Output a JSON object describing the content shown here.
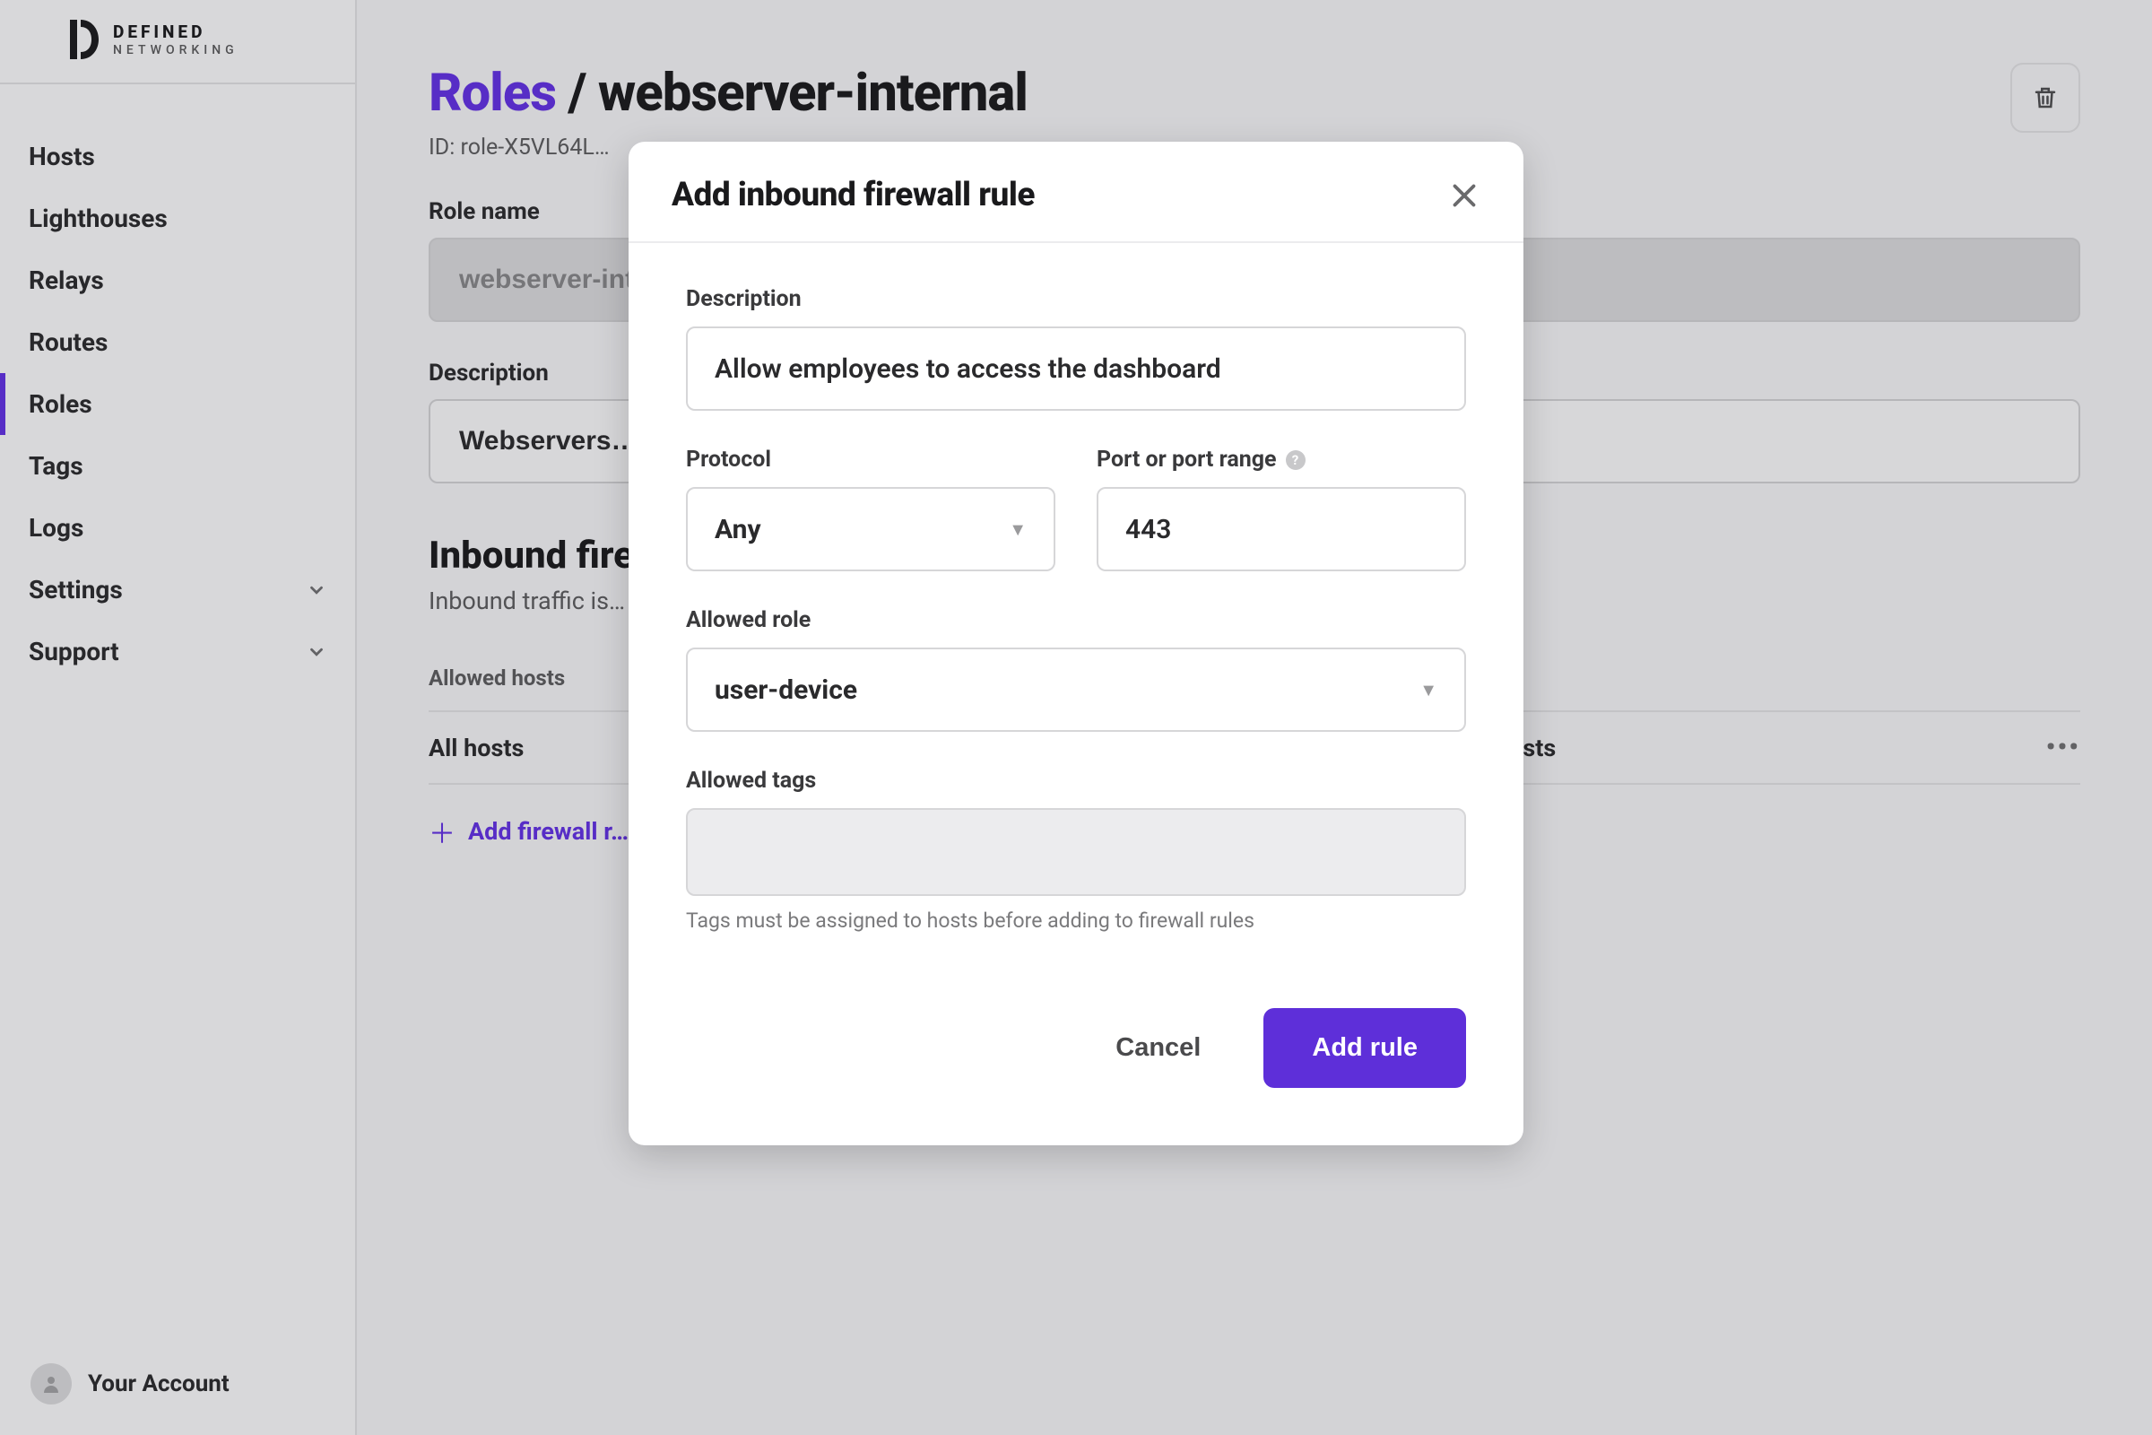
{
  "brand": {
    "line1": "DEFINED",
    "line2": "NETWORKING"
  },
  "nav": {
    "items": [
      {
        "label": "Hosts"
      },
      {
        "label": "Lighthouses"
      },
      {
        "label": "Relays"
      },
      {
        "label": "Routes"
      },
      {
        "label": "Roles",
        "active": true
      },
      {
        "label": "Tags"
      },
      {
        "label": "Logs"
      },
      {
        "label": "Settings",
        "expandable": true
      },
      {
        "label": "Support",
        "expandable": true
      }
    ]
  },
  "account": {
    "label": "Your Account"
  },
  "page": {
    "breadcrumb_root": "Roles",
    "breadcrumb_sep": " / ",
    "title": "webserver-internal",
    "role_id_label": "ID: role-X5VL64L…",
    "role_name_label": "Role name",
    "role_name_value": "webserver-internal",
    "description_label": "Description",
    "description_value": "Webservers…",
    "inbound_title": "Inbound firew…",
    "inbound_desc": "Inbound traffic is…                                                                                              c roles.",
    "table": {
      "col_hosts": "Allowed hosts",
      "col_desc": "",
      "row_hosts": "All hosts",
      "row_desc": "…g requests from other hosts"
    },
    "add_rule_link": "Add firewall r…"
  },
  "modal": {
    "title": "Add inbound firewall rule",
    "description_label": "Description",
    "description_value": "Allow employees to access the dashboard",
    "protocol_label": "Protocol",
    "protocol_value": "Any",
    "port_label": "Port or port range",
    "port_value": "443",
    "allowed_role_label": "Allowed role",
    "allowed_role_value": "user-device",
    "allowed_tags_label": "Allowed tags",
    "tags_hint": "Tags must be assigned to hosts before adding to firewall rules",
    "cancel": "Cancel",
    "submit": "Add rule"
  }
}
